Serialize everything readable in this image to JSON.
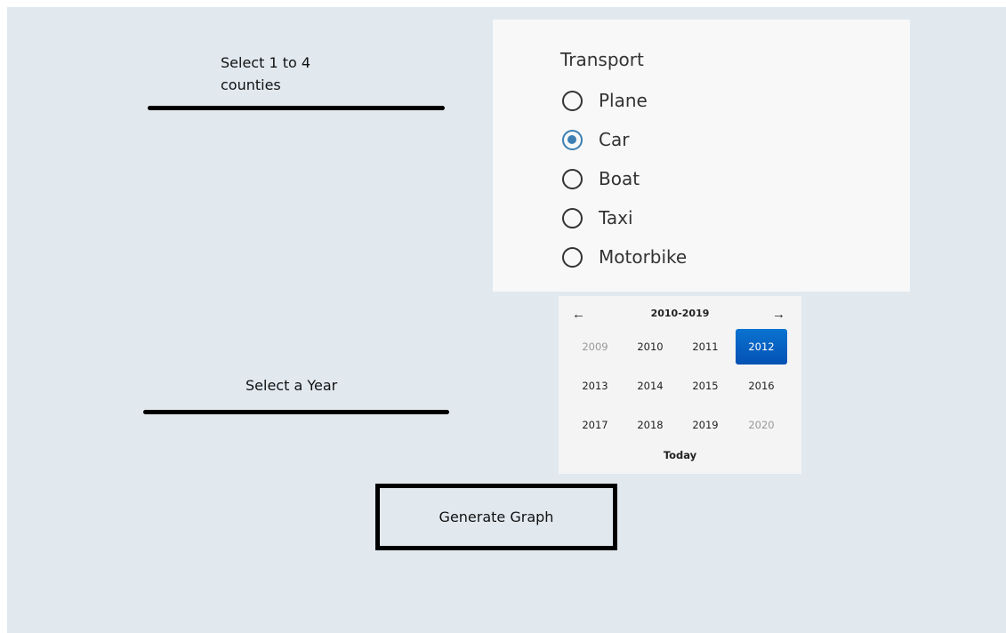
{
  "counties": {
    "label_line1": "Select 1 to 4",
    "label_line2": "counties"
  },
  "transport": {
    "title": "Transport",
    "options": [
      {
        "label": "Plane",
        "checked": false
      },
      {
        "label": "Car",
        "checked": true
      },
      {
        "label": "Boat",
        "checked": false
      },
      {
        "label": "Taxi",
        "checked": false
      },
      {
        "label": "Motorbike",
        "checked": false
      }
    ],
    "accent_color": "#3c7fb3"
  },
  "year": {
    "label": "Select a Year"
  },
  "year_picker": {
    "prev_icon": "arrow-left-icon",
    "next_icon": "arrow-right-icon",
    "decade": "2010-2019",
    "rows": [
      [
        "2009",
        "2010",
        "2011",
        "2012"
      ],
      [
        "2013",
        "2014",
        "2015",
        "2016"
      ],
      [
        "2017",
        "2018",
        "2019",
        "2020"
      ]
    ],
    "muted_years": [
      "2009",
      "2020"
    ],
    "selected_year": "2012",
    "selected_color": "#0a64c6",
    "today_label": "Today"
  },
  "generate": {
    "label": "Generate Graph"
  }
}
